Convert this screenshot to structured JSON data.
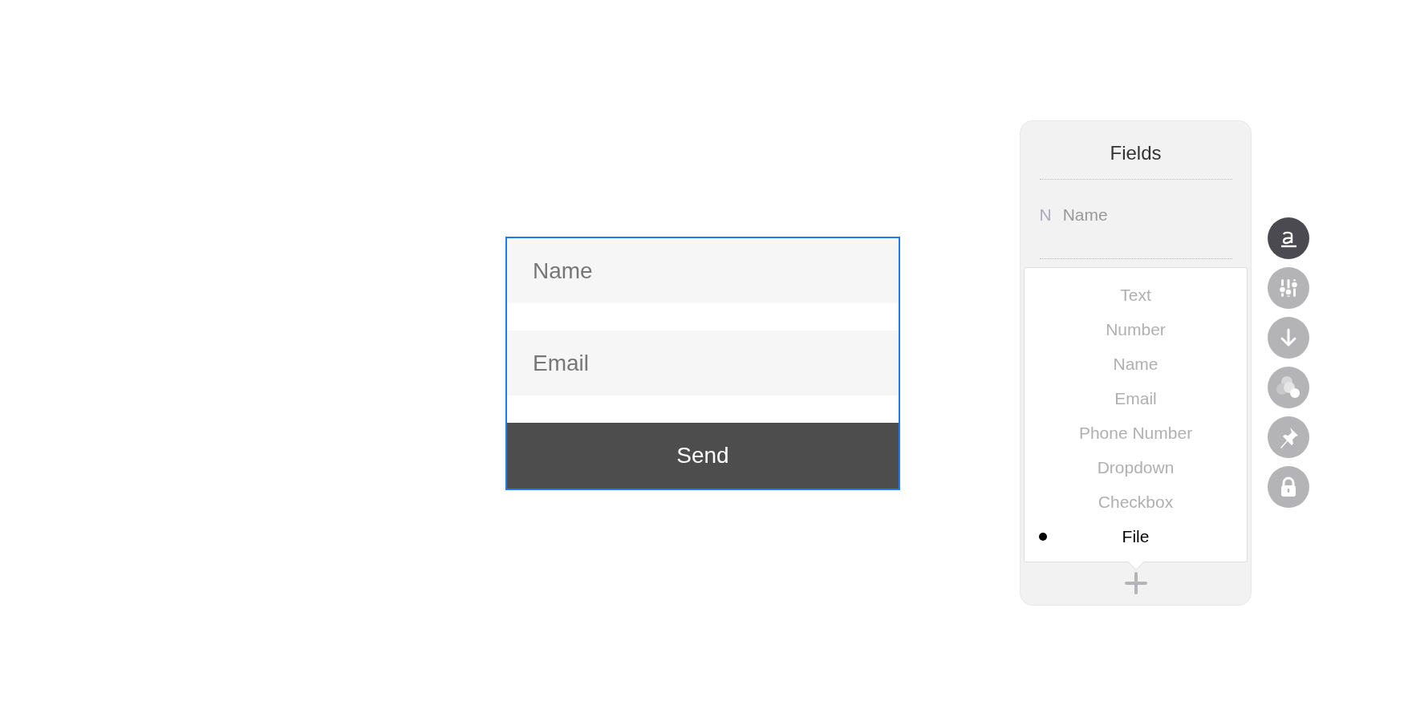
{
  "form": {
    "selected": true,
    "fields": [
      {
        "placeholder": "Name"
      },
      {
        "placeholder": "Email"
      }
    ],
    "submit": "Send"
  },
  "fields_panel": {
    "title": "Fields",
    "fields": [
      {
        "initial": "N",
        "label": "Name"
      }
    ],
    "types": [
      {
        "label": "Text",
        "selected": false
      },
      {
        "label": "Number",
        "selected": false
      },
      {
        "label": "Name",
        "selected": false
      },
      {
        "label": "Email",
        "selected": false
      },
      {
        "label": "Phone Number",
        "selected": false
      },
      {
        "label": "Dropdown",
        "selected": false
      },
      {
        "label": "Checkbox",
        "selected": false
      },
      {
        "label": "File",
        "selected": true
      }
    ]
  },
  "tools": [
    {
      "kind": "text",
      "selected": true
    },
    {
      "kind": "sliders",
      "selected": false
    },
    {
      "kind": "download",
      "selected": false
    },
    {
      "kind": "colors",
      "selected": false
    },
    {
      "kind": "pin",
      "selected": false
    },
    {
      "kind": "lock",
      "selected": false
    }
  ]
}
